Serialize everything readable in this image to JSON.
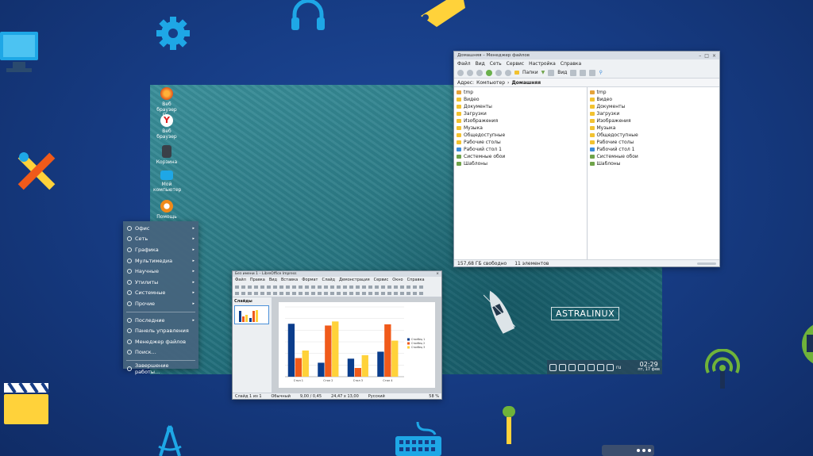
{
  "colors": {
    "background": "#173d86",
    "menu_bg": "#46647d",
    "bar_blue": "#0a3d8c",
    "bar_orange": "#f05a1a",
    "bar_yellow": "#ffd23a"
  },
  "desktop": {
    "icons": [
      {
        "label": "Веб браузер Fi...",
        "icon": "firefox-icon"
      },
      {
        "label": "Веб браузер",
        "icon": "yandex-browser-icon"
      },
      {
        "label": "Корзина",
        "icon": "trash-icon"
      },
      {
        "label": "Мой компьютер",
        "icon": "computer-icon"
      },
      {
        "label": "Помощь",
        "icon": "help-lifebuoy-icon"
      }
    ],
    "logo_text": "ASTRALINUX",
    "clock_time": "02:29",
    "clock_date": "пт, 17 фев",
    "keyboard_layout": "ru"
  },
  "file_manager": {
    "title": "Домашняя – Менеджер файлов",
    "menu": [
      "Файл",
      "Вид",
      "Сеть",
      "Сервис",
      "Настройка",
      "Справка"
    ],
    "toolbar": {
      "folders_label": "Папки",
      "view_label": "Вид"
    },
    "address_label": "Адрес:",
    "breadcrumb": [
      "Компьютер",
      "Домашняя"
    ],
    "left_items": [
      "tmp",
      "Видео",
      "Документы",
      "Загрузки",
      "Изображения",
      "Музыка",
      "Общедоступные",
      "Рабочие столы",
      "Рабочий стол 1",
      "Системные обои",
      "Шаблоны"
    ],
    "right_items": [
      "tmp",
      "Видео",
      "Документы",
      "Загрузки",
      "Изображения",
      "Музыка",
      "Общедоступные",
      "Рабочие столы",
      "Рабочий стол 1",
      "Системные обои",
      "Шаблоны"
    ],
    "status_free": "157,68 ГБ свободно",
    "status_count": "11 элементов"
  },
  "start_menu": {
    "items": [
      {
        "label": "Офис",
        "submenu": true
      },
      {
        "label": "Сеть",
        "submenu": true
      },
      {
        "label": "Графика",
        "submenu": true
      },
      {
        "label": "Мультимедиа",
        "submenu": true
      },
      {
        "label": "Научные",
        "submenu": true
      },
      {
        "label": "Утилиты",
        "submenu": true
      },
      {
        "label": "Системные",
        "submenu": true
      },
      {
        "label": "Прочие",
        "submenu": true
      }
    ],
    "items2": [
      {
        "label": "Последние",
        "submenu": true
      },
      {
        "label": "Панель управления",
        "submenu": false
      },
      {
        "label": "Менеджер файлов",
        "submenu": false
      },
      {
        "label": "Поиск...",
        "submenu": false
      }
    ],
    "shutdown": "Завершение работы..."
  },
  "impress": {
    "title": "Без имени 1 – LibreOffice Impress",
    "menu": [
      "Файл",
      "Правка",
      "Вид",
      "Вставка",
      "Формат",
      "Слайд",
      "Демонстрация",
      "Сервис",
      "Окно",
      "Справка"
    ],
    "slides_panel": "Слайды",
    "status": [
      "Слайд 1 из 1",
      "Обычный",
      "9,00 / 0,45",
      "24,47 x 13,00",
      "Русский",
      "58 %"
    ]
  },
  "chart_data": {
    "type": "bar",
    "categories": [
      "Стол 1",
      "Стол 2",
      "Стол 3",
      "Стол 4"
    ],
    "series": [
      {
        "name": "Столбец 1",
        "values": [
          9.1,
          2.4,
          3.1,
          4.3
        ]
      },
      {
        "name": "Столбец 2",
        "values": [
          3.2,
          8.8,
          1.5,
          9.0
        ]
      },
      {
        "name": "Столбец 3",
        "values": [
          4.5,
          9.5,
          3.7,
          6.2
        ]
      }
    ],
    "ylim": [
      0,
      12
    ],
    "legend_position": "right",
    "grid": true
  }
}
